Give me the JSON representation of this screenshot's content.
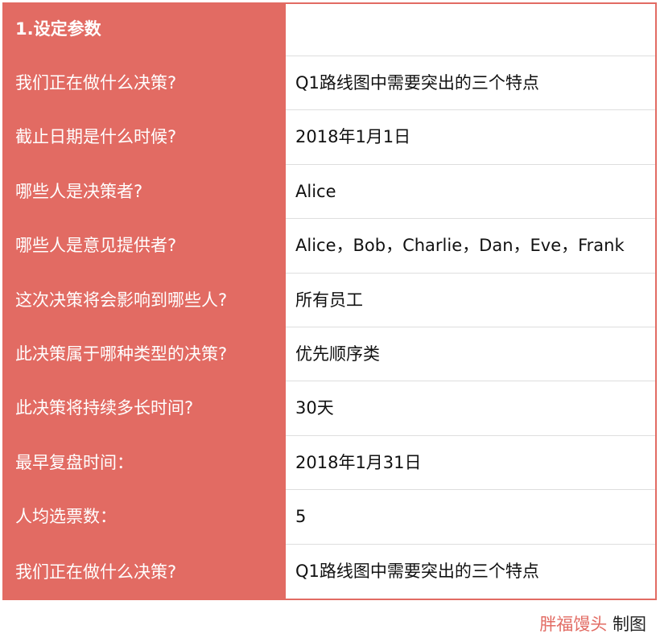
{
  "table": {
    "rows": [
      {
        "label": "1.设定参数",
        "value": ""
      },
      {
        "label": "我们正在做什么决策?",
        "value": "Q1路线图中需要突出的三个特点"
      },
      {
        "label": "截止日期是什么时候?",
        "value": "2018年1月1日"
      },
      {
        "label": "哪些人是决策者?",
        "value": "Alice"
      },
      {
        "label": "哪些人是意见提供者?",
        "value": "Alice，Bob，Charlie，Dan，Eve，Frank"
      },
      {
        "label": "这次决策将会影响到哪些人?",
        "value": "所有员工"
      },
      {
        "label": "此决策属于哪种类型的决策?",
        "value": "优先顺序类"
      },
      {
        "label": "此决策将持续多长时间?",
        "value": "30天"
      },
      {
        "label": "最早复盘时间：",
        "value": "2018年1月31日"
      },
      {
        "label": "人均选票数：",
        "value": "5"
      },
      {
        "label": "我们正在做什么决策?",
        "value": "Q1路线图中需要突出的三个特点"
      }
    ]
  },
  "credit": {
    "brand": "胖福馒头",
    "suffix": "制图"
  },
  "colors": {
    "accent": "#e26b63",
    "label_text": "#ffffff",
    "value_text": "#111111",
    "divider": "#dedede"
  }
}
